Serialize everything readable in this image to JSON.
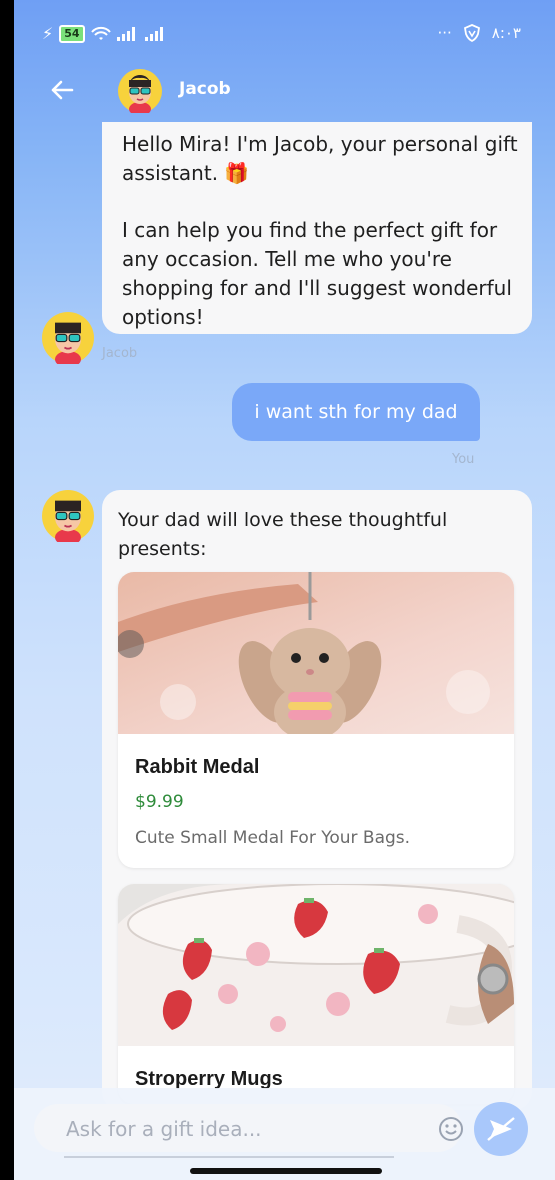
{
  "status_bar": {
    "battery": "54",
    "time": "۸:۰۳",
    "dots": "···"
  },
  "header": {
    "contact_name": "Jacob"
  },
  "messages": {
    "bot_intro": {
      "line1": "Hello Mira! I'm Jacob, your personal gift",
      "line2": "assistant. 🎁",
      "line3": "I can help you find the perfect gift for",
      "line4": "any occasion. Tell me who you're",
      "line5": "shopping for and I'll suggest wonderful",
      "line6": "options!",
      "sender": "Jacob"
    },
    "user_msg": {
      "text": "i want sth for my dad",
      "sender": "You"
    },
    "bot_reply": {
      "line1": "Your dad will love these thoughtful",
      "line2": "presents:"
    }
  },
  "products": [
    {
      "title": "Rabbit Medal",
      "price": "$9.99",
      "description": "Cute Small Medal For Your Bags."
    },
    {
      "title": "Stroperry Mugs"
    }
  ],
  "input": {
    "placeholder": "Ask for a gift idea..."
  },
  "colors": {
    "accent": "#7aa8f8",
    "price": "#2e8b3a",
    "header_bg": "#6f9ff4"
  }
}
